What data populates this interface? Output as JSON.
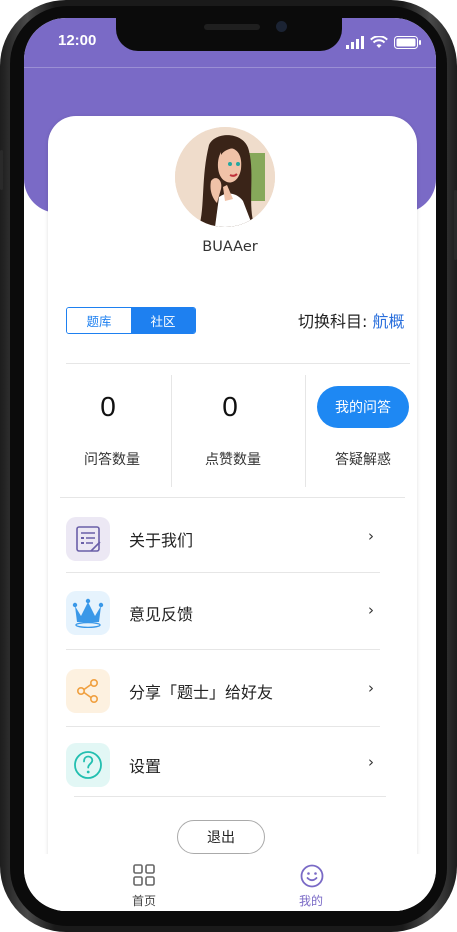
{
  "status_bar": {
    "time": "12:00"
  },
  "profile": {
    "username": "BUAAer"
  },
  "segment": {
    "options": [
      "题库",
      "社区"
    ],
    "selected": "社区"
  },
  "subject": {
    "label": "切换科目:",
    "value": "航概"
  },
  "stats": [
    {
      "value": "0",
      "label": "问答数量"
    },
    {
      "value": "0",
      "label": "点赞数量"
    }
  ],
  "ask": {
    "button_label": "我的问答",
    "caption": "答疑解惑"
  },
  "menu": [
    {
      "label": "关于我们",
      "icon": "document-list-icon",
      "chevron": "›"
    },
    {
      "label": "意见反馈",
      "icon": "crown-icon",
      "chevron": "›"
    },
    {
      "label": "分享「题士」给好友",
      "icon": "share-icon",
      "chevron": "›"
    },
    {
      "label": "设置",
      "icon": "question-circle-icon",
      "chevron": "›"
    }
  ],
  "logout_label": "退出",
  "tabbar": [
    {
      "label": "首页",
      "icon": "grid-icon",
      "active": false
    },
    {
      "label": "我的",
      "icon": "smiley-icon",
      "active": true
    }
  ],
  "colors": {
    "header_purple": "#7a6ac6",
    "primary_blue": "#1e80f0",
    "tab_active": "#7a6ac6"
  }
}
